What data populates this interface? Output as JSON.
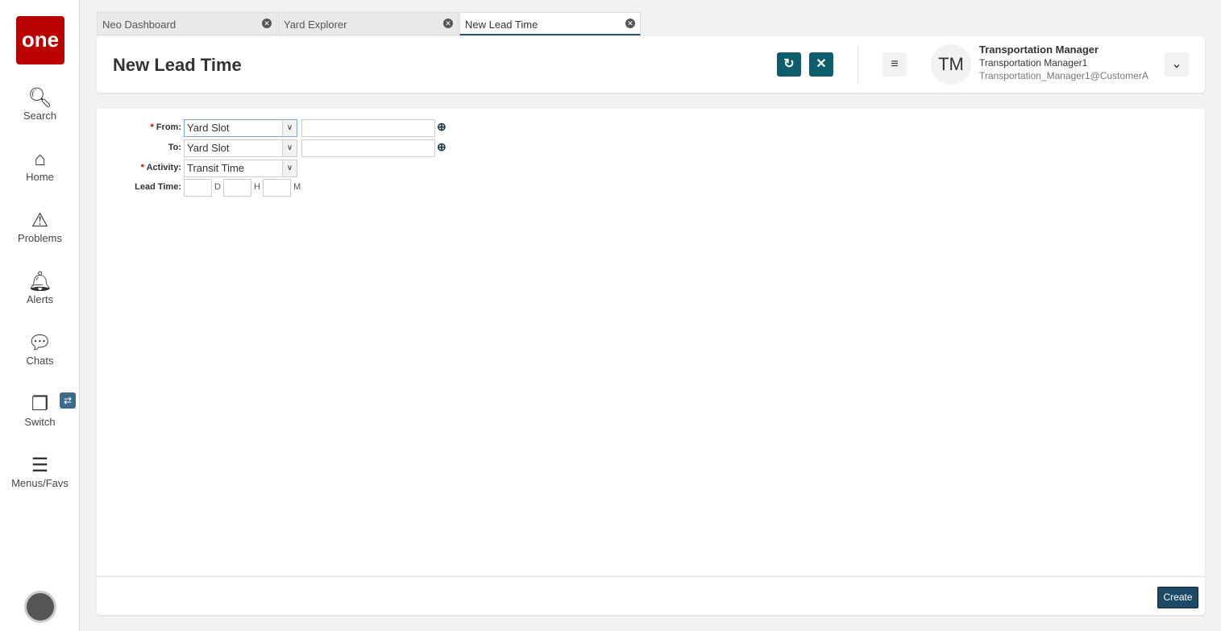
{
  "sidebar": {
    "logo": "one",
    "items": [
      {
        "label": "Search"
      },
      {
        "label": "Home"
      },
      {
        "label": "Problems"
      },
      {
        "label": "Alerts"
      },
      {
        "label": "Chats"
      },
      {
        "label": "Switch"
      },
      {
        "label": "Menus/Favs"
      }
    ]
  },
  "tabs": [
    {
      "label": "Neo Dashboard"
    },
    {
      "label": "Yard Explorer"
    },
    {
      "label": "New Lead Time"
    }
  ],
  "header": {
    "title": "New Lead Time",
    "user_initials": "TM",
    "user_role": "Transportation Manager",
    "user_name": "Transportation Manager1",
    "user_account": "Transportation_Manager1@CustomerA"
  },
  "form": {
    "from_label": "From:",
    "from_value": "Yard Slot",
    "to_label": "To:",
    "to_value": "Yard Slot",
    "activity_label": "Activity:",
    "activity_value": "Transit Time",
    "lead_time_label": "Lead Time:",
    "unit_d": "D",
    "unit_h": "H",
    "unit_m": "M",
    "required_mark": "*"
  },
  "footer": {
    "create_label": "Create"
  }
}
